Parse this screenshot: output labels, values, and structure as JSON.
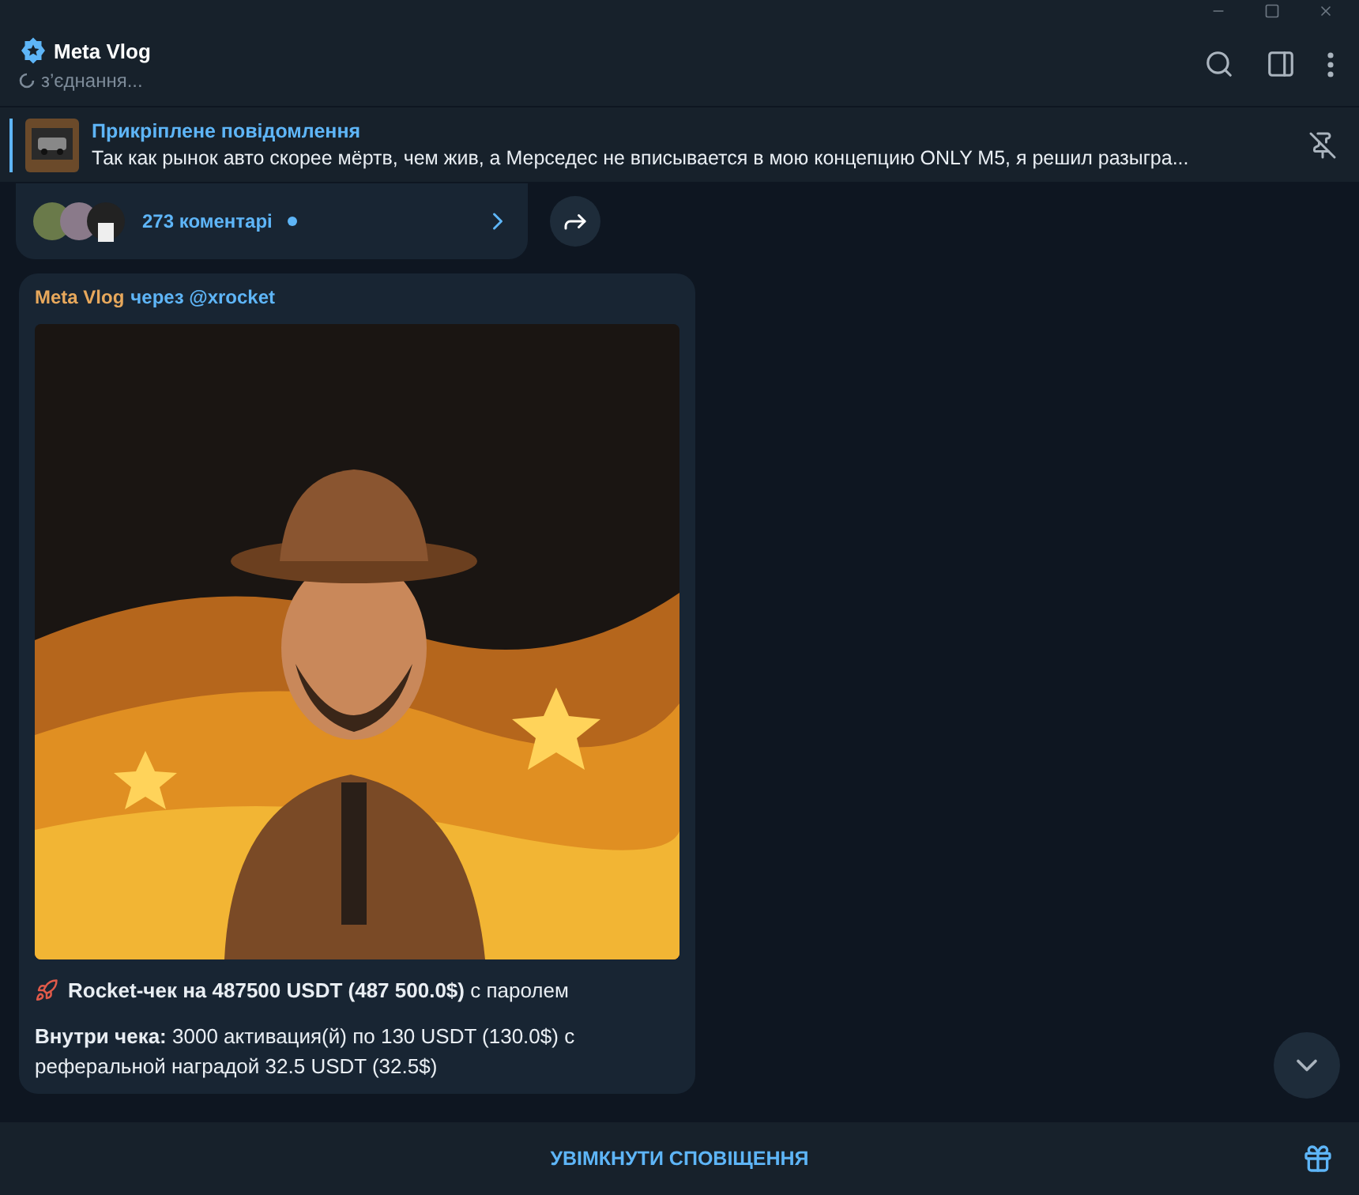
{
  "header": {
    "title": "Meta Vlog",
    "status": "з’єднання..."
  },
  "pinned": {
    "label": "Прикріплене повідомлення",
    "text": "Так как рынок авто скорее мёртв, чем жив, а Мерседес не вписывается в мою концепцию ONLY M5, я решил разыгра..."
  },
  "comments": {
    "count": "273 коментарі",
    "unread": true
  },
  "message": {
    "author": "Meta Vlog",
    "via": "через @xrocket",
    "paragraphs": [
      "**Rocket-чек на 487500 USDT (487 500.0$)** с паролем",
      "**Внутри чека:** 3000 активация(й) по 130 USDT (130.0$) с реферальной наградой 32.5 USDT (32.5$)"
    ]
  },
  "bottom_bar": {
    "action": "УВІМКНУТИ СПОВІЩЕННЯ"
  }
}
